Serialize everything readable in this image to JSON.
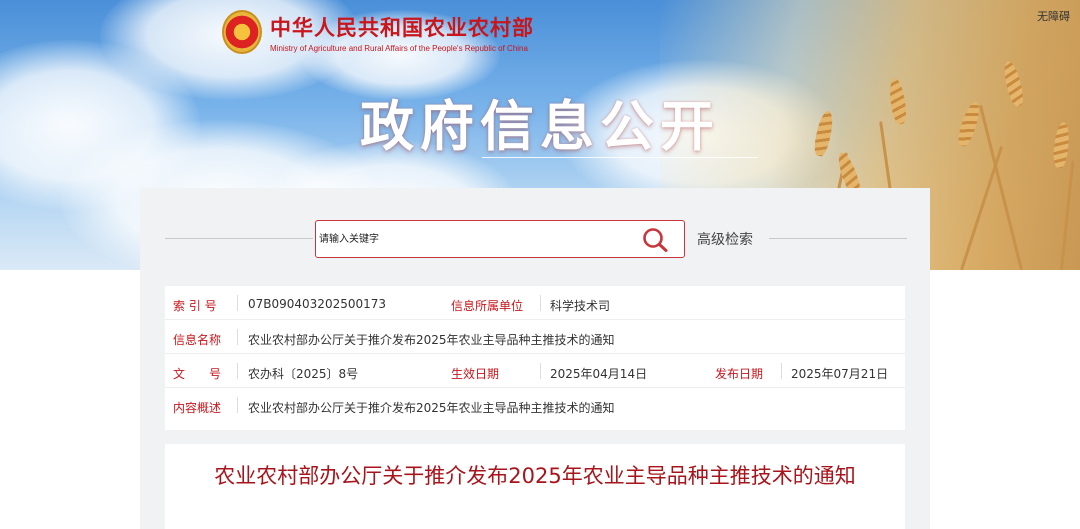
{
  "header": {
    "ministry_name_cn": "中华人民共和国农业农村部",
    "ministry_name_en": "Ministry of Agriculture and Rural Affairs of the People's Republic of China",
    "accessibility_label": "无障碍",
    "hero_title": "政府信息公开"
  },
  "search": {
    "placeholder": "请输入关键字",
    "advanced_label": "高级检索"
  },
  "info": {
    "index_label": "索 引 号",
    "index_value": "07B090403202500173",
    "unit_label": "信息所属单位",
    "unit_value": "科学技术司",
    "name_label": "信息名称",
    "name_value": "农业农村部办公厅关于推介发布2025年农业主导品种主推技术的通知",
    "doc_label": "文　　号",
    "doc_value": "农办科〔2025〕8号",
    "effective_label": "生效日期",
    "effective_value": "2025年04月14日",
    "publish_label": "发布日期",
    "publish_value": "2025年07月21日",
    "summary_label": "内容概述",
    "summary_value": "农业农村部办公厅关于推介发布2025年农业主导品种主推技术的通知"
  },
  "article": {
    "title": "农业农村部办公厅关于推介发布2025年农业主导品种主推技术的通知"
  },
  "colors": {
    "accent_red": "#c8161d",
    "title_red": "#a8141b"
  }
}
